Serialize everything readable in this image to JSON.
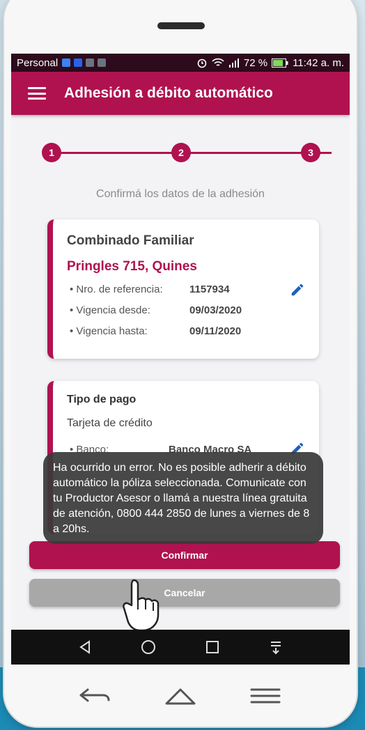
{
  "status_bar": {
    "carrier": "Personal",
    "battery": "72 %",
    "time": "11:42 a. m."
  },
  "app_bar": {
    "title": "Adhesión a débito automático"
  },
  "stepper": {
    "steps": [
      "1",
      "2",
      "3"
    ]
  },
  "subtitle": "Confirmá los datos de la adhesión",
  "policy_card": {
    "title": "Combinado Familiar",
    "address": "Pringles 715, Quines",
    "rows": [
      {
        "label": "• Nro. de referencia:",
        "value": "1157934"
      },
      {
        "label": "• Vigencia desde:",
        "value": "09/03/2020"
      },
      {
        "label": "• Vigencia hasta:",
        "value": "09/11/2020"
      }
    ]
  },
  "payment_card": {
    "title": "Tipo de pago",
    "method": "Tarjeta de crédito",
    "rows": [
      {
        "label": "• Banco:",
        "value": "Banco Macro SA"
      }
    ]
  },
  "toast": {
    "message": "Ha ocurrido un error. No es posible adherir a débito automático la póliza seleccionada. Comunicate con tu Productor Asesor o llamá a nuestra línea gratuita de atención, 0800 444 2850 de lunes a viernes de 8 a 20hs."
  },
  "buttons": {
    "confirm": "Confirmar",
    "cancel": "Cancelar"
  },
  "colors": {
    "brand": "#b0124f",
    "status_bar": "#2d0a1c",
    "toast": "#3a3a3a",
    "cancel": "#a8a8a8"
  },
  "icons": {
    "menu": "hamburger-menu-icon",
    "edit": "pencil-icon",
    "pointer": "hand-pointer-icon",
    "nav": [
      "back-triangle-icon",
      "home-circle-icon",
      "recents-square-icon",
      "notifications-icon"
    ],
    "hardware": [
      "back-arrow-icon",
      "home-outline-icon",
      "menu-lines-icon"
    ]
  }
}
